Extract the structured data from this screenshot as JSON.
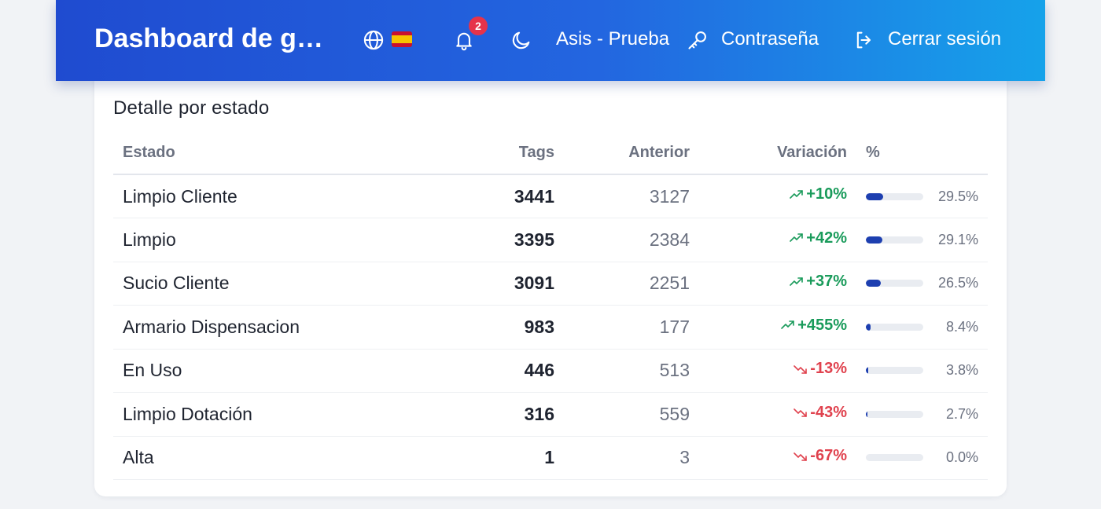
{
  "header": {
    "title": "Dashboard de gestión",
    "language_icon": "globe-icon",
    "flag": "es-flag",
    "notifications_count": "2",
    "user_label": "Asis - Prueba",
    "password_label": "Contraseña",
    "logout_label": "Cerrar sesión"
  },
  "section": {
    "title": "Detalle por estado"
  },
  "table": {
    "headers": {
      "estado": "Estado",
      "tags": "Tags",
      "anterior": "Anterior",
      "variacion": "Variación",
      "pct": "%"
    },
    "rows": [
      {
        "estado": "Limpio Cliente",
        "tags": "3441",
        "anterior": "3127",
        "variacion": "+10%",
        "trend": "up",
        "pct": "29.5%",
        "pct_value": 29.5
      },
      {
        "estado": "Limpio",
        "tags": "3395",
        "anterior": "2384",
        "variacion": "+42%",
        "trend": "up",
        "pct": "29.1%",
        "pct_value": 29.1
      },
      {
        "estado": "Sucio Cliente",
        "tags": "3091",
        "anterior": "2251",
        "variacion": "+37%",
        "trend": "up",
        "pct": "26.5%",
        "pct_value": 26.5
      },
      {
        "estado": "Armario Dispensacion",
        "tags": "983",
        "anterior": "177",
        "variacion": "+455%",
        "trend": "up",
        "pct": "8.4%",
        "pct_value": 8.4
      },
      {
        "estado": "En Uso",
        "tags": "446",
        "anterior": "513",
        "variacion": "-13%",
        "trend": "down",
        "pct": "3.8%",
        "pct_value": 3.8
      },
      {
        "estado": "Limpio Dotación",
        "tags": "316",
        "anterior": "559",
        "variacion": "-43%",
        "trend": "down",
        "pct": "2.7%",
        "pct_value": 2.7
      },
      {
        "estado": "Alta",
        "tags": "1",
        "anterior": "3",
        "variacion": "-67%",
        "trend": "down",
        "pct": "0.0%",
        "pct_value": 0.0
      }
    ]
  },
  "colors": {
    "header_start": "#1f4bd0",
    "header_end": "#16a2ea",
    "up": "#1a9b5b",
    "down": "#e0424e",
    "bar": "#1d3fb0",
    "badge": "#e6334a"
  }
}
